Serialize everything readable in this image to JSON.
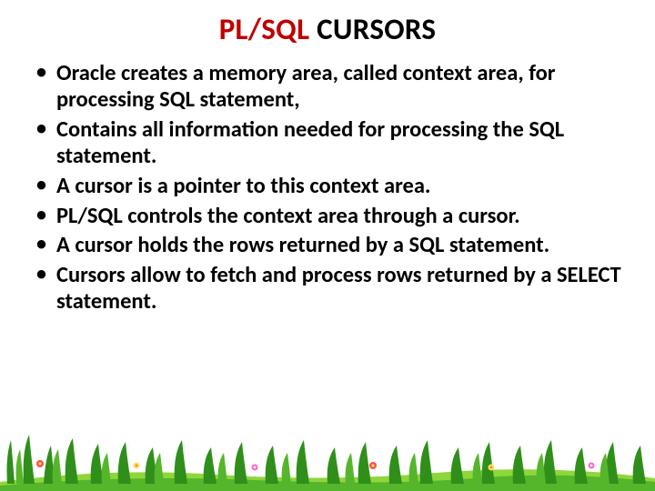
{
  "title": {
    "part1": "PL/SQL",
    "part2": " CURSORS"
  },
  "bullets": [
    "Oracle creates a memory area, called context area, for processing SQL statement,",
    "Contains all information needed for processing the SQL statement.",
    "A cursor is a pointer to this context area.",
    "PL/SQL controls the context area through a cursor.",
    "A cursor holds the rows returned by a SQL statement.",
    "Cursors allow to fetch and process rows returned by a SELECT statement."
  ],
  "colors": {
    "accent_red": "#c00000",
    "text": "#000000",
    "grass_dark": "#2f8f1a",
    "grass_mid": "#55b52b",
    "grass_light": "#8fd63a"
  }
}
